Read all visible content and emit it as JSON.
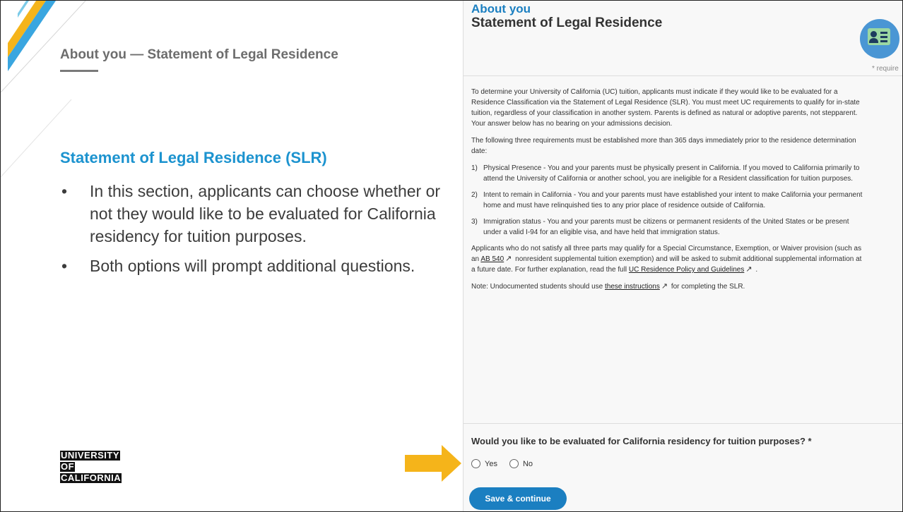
{
  "slide": {
    "title": "About you — Statement of Legal Residence",
    "section_heading": "Statement of Legal Residence (SLR)",
    "bullets": [
      "In this section, applicants can choose whether or not they would like to be evaluated for California residency for tuition purposes.",
      "Both options will prompt additional questions."
    ],
    "bullet_symbol": "•",
    "logo": [
      "UNIVERSITY",
      "OF",
      "CALIFORNIA"
    ]
  },
  "app": {
    "section_label": "About you",
    "page_title": "Statement of Legal Residence",
    "required_note": "* require",
    "intro": "To determine your University of California (UC) tuition, applicants must indicate if they would like to be evaluated for a Residence Classification via the Statement of Legal Residence (SLR). You must meet UC requirements to qualify for in-state tuition, regardless of your classification in another system. Parents is defined as natural or adoptive parents, not stepparent. Your answer below has no bearing on your admissions decision.",
    "requirements_intro": "The following three requirements must be established more than 365 days immediately prior to the residence determination date:",
    "requirements": [
      {
        "num": "1)",
        "text": "Physical Presence - You and your parents must be physically present in California. If you moved to California primarily to attend the University of California or another school, you are ineligible for a Resident classification for tuition purposes."
      },
      {
        "num": "2)",
        "text": "Intent to remain in California - You and your parents must have established your intent to make California your permanent home and must have relinquished ties to any prior place of residence outside of California."
      },
      {
        "num": "3)",
        "text": "Immigration status - You and your parents must be citizens or permanent residents of the United States or be present under a valid I-94 for an eligible visa, and have held that immigration status."
      }
    ],
    "exemption": {
      "part1": "Applicants who do not satisfy all three parts may qualify for a Special Circumstance, Exemption, or Waiver provision (such as an ",
      "link1": "AB 540",
      "part2": " nonresident supplemental tuition exemption) and will be asked to submit additional supplemental information at a future date. For further explanation, read the full ",
      "link2": "UC Residence Policy and Guidelines",
      "part3": " ."
    },
    "note": {
      "part1": "Note: Undocumented students should use ",
      "link": "these instructions",
      "part2": " for completing the SLR."
    },
    "external_icon": "↗",
    "question": "Would you like to be evaluated for California residency for tuition purposes? *",
    "options": [
      "Yes",
      "No"
    ],
    "save_button": "Save & continue"
  },
  "colors": {
    "accent_blue": "#1b7fc1",
    "heading_blue": "#1c93cf",
    "arrow_orange": "#f5b41a"
  }
}
